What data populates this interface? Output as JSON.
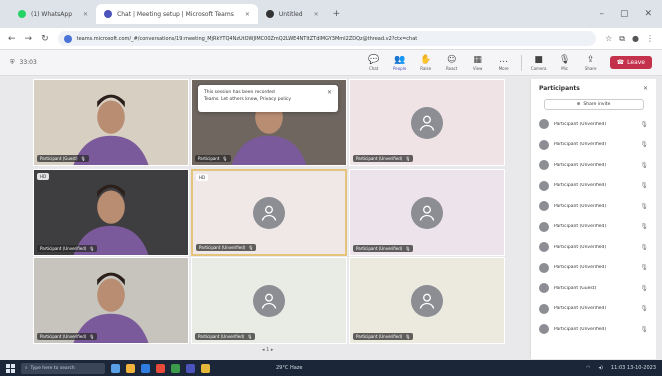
{
  "browser": {
    "tabs": [
      {
        "label": "(1) WhatsApp",
        "active": false,
        "color": "#25d366"
      },
      {
        "label": "Chat | Meeting setup | Microsoft Teams",
        "active": true,
        "color": "#4b53bc"
      },
      {
        "label": "Untitled",
        "active": false,
        "color": "#333333"
      }
    ],
    "new_tab": "+",
    "url": "teams.microsoft.com/_#/conversations/19:meeting_MjRkYTQ4NzUtOWJlMC00ZmQ2LWE4NTItZTdlMGY3MmI2ZDQz@thread.v2?ctx=chat",
    "min": "–",
    "max": "▢",
    "close": "✕"
  },
  "meeting": {
    "timer": "33:03",
    "controls": [
      {
        "label": "Chat",
        "icon": "💬"
      },
      {
        "label": "People",
        "icon": "👥",
        "active": true
      },
      {
        "label": "Raise",
        "icon": "✋"
      },
      {
        "label": "React",
        "icon": "☺"
      },
      {
        "label": "View",
        "icon": "▦"
      },
      {
        "label": "More",
        "icon": "…"
      },
      {
        "label": "Camera",
        "icon": "■"
      },
      {
        "label": "Mic",
        "icon": "🎙"
      },
      {
        "label": "Share",
        "icon": "⇪"
      }
    ],
    "leave_label": "Leave"
  },
  "popup": {
    "line1": "This session has been recorded",
    "line2": "Teams. Let others know, Privacy policy"
  },
  "tiles": [
    {
      "name": "Participant (Guest)",
      "type": "camera",
      "bg": "#d8cfc3"
    },
    {
      "name": "Participant",
      "type": "camera",
      "bg": "#6f6660"
    },
    {
      "name": "Participant (Unverified)",
      "type": "avatar",
      "bg": "#efe3e6"
    },
    {
      "name": "Participant (Unverified)",
      "type": "camera",
      "bg": "#3e3d3f",
      "badge": "HD"
    },
    {
      "name": "Participant (Unverified)",
      "type": "avatar",
      "bg": "#efe8e6",
      "badge": "HD",
      "speaking": true
    },
    {
      "name": "Participant (Unverified)",
      "type": "avatar",
      "bg": "#ede3ea"
    },
    {
      "name": "Participant (Unverified)",
      "type": "camera",
      "bg": "#c7c3bd"
    },
    {
      "name": "Participant (Unverified)",
      "type": "avatar",
      "bg": "#e8ece5"
    },
    {
      "name": "Participant (Unverified)",
      "type": "avatar",
      "bg": "#ece9df"
    }
  ],
  "pager": "◂ 1 ▸",
  "panel": {
    "title": "Participants",
    "close": "✕",
    "invite_label": "Share invite",
    "participants": [
      "Participant (Unverified)",
      "Participant (Unverified)",
      "Participant (Unverified)",
      "Participant (Unverified)",
      "Participant (Unverified)",
      "Participant (Unverified)",
      "Participant (Unverified)",
      "Participant (Unverified)",
      "Participant (Guest)",
      "Participant (Unverified)",
      "Participant (Unverified)"
    ]
  },
  "taskbar": {
    "search_placeholder": "Type here to search",
    "weather": "29°C Haze",
    "time": "11:03",
    "date": "13-10-2023"
  }
}
